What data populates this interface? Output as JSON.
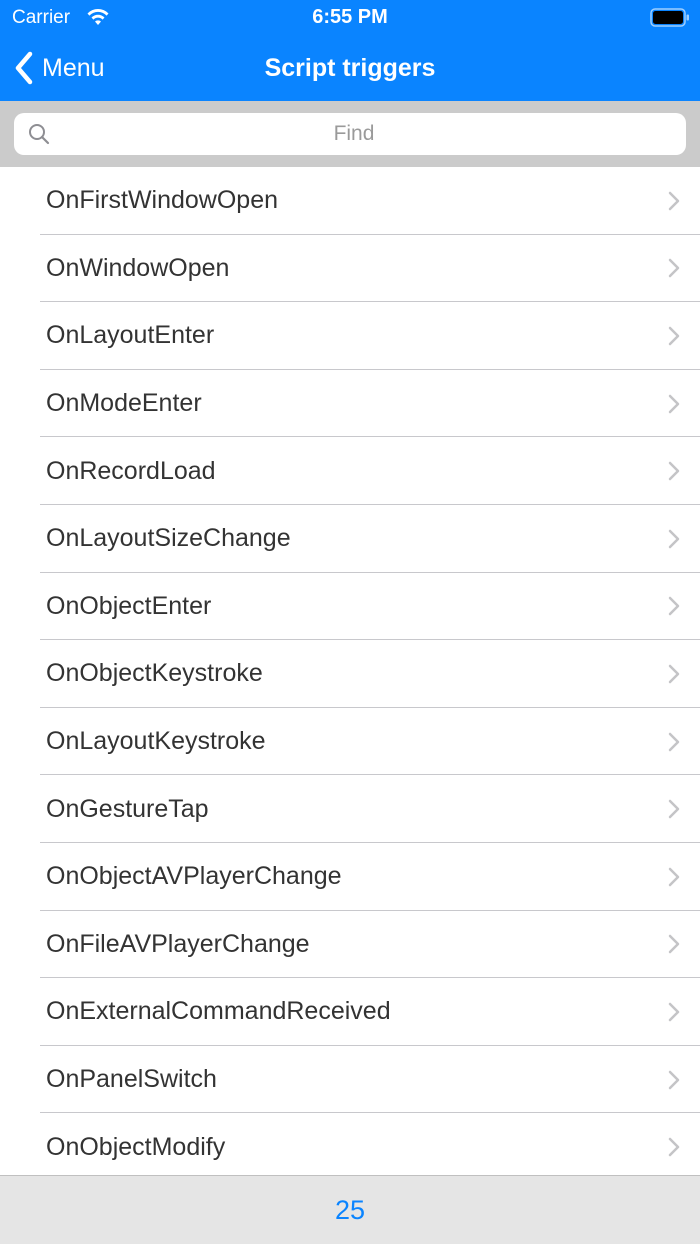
{
  "status_bar": {
    "carrier": "Carrier",
    "time": "6:55 PM"
  },
  "nav": {
    "back_label": "Menu",
    "title": "Script triggers"
  },
  "search": {
    "placeholder": "Find",
    "value": ""
  },
  "list": {
    "items": [
      {
        "label": "OnFirstWindowOpen"
      },
      {
        "label": "OnWindowOpen"
      },
      {
        "label": "OnLayoutEnter"
      },
      {
        "label": "OnModeEnter"
      },
      {
        "label": "OnRecordLoad"
      },
      {
        "label": "OnLayoutSizeChange"
      },
      {
        "label": "OnObjectEnter"
      },
      {
        "label": "OnObjectKeystroke"
      },
      {
        "label": "OnLayoutKeystroke"
      },
      {
        "label": "OnGestureTap"
      },
      {
        "label": "OnObjectAVPlayerChange"
      },
      {
        "label": "OnFileAVPlayerChange"
      },
      {
        "label": "OnExternalCommandReceived"
      },
      {
        "label": "OnPanelSwitch"
      },
      {
        "label": "OnObjectModify"
      }
    ]
  },
  "footer": {
    "count": "25"
  },
  "colors": {
    "accent": "#0a84ff",
    "search_bar_bg": "#cbcbcb",
    "footer_bg": "#e5e5e5"
  },
  "icons": {
    "back": "chevron-left-icon",
    "search": "magnifier-icon",
    "row_disclosure": "chevron-right-icon",
    "wifi": "wifi-icon",
    "battery": "battery-icon"
  }
}
